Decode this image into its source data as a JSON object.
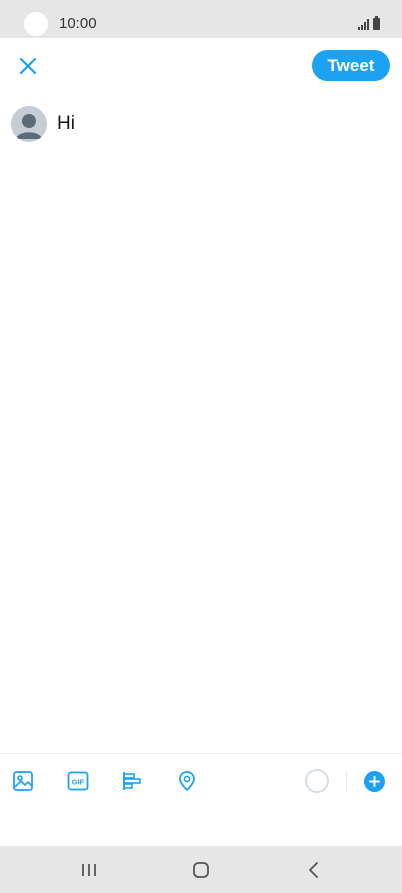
{
  "status_bar": {
    "time": "10:00",
    "icons": [
      "signal-icon",
      "battery-icon"
    ]
  },
  "header": {
    "close_icon": "close-icon",
    "tweet_label": "Tweet"
  },
  "compose": {
    "avatar_icon": "default-avatar-icon",
    "text": "Hi"
  },
  "toolbar": {
    "items": [
      "image-icon",
      "gif-icon",
      "poll-icon",
      "location-icon"
    ],
    "gif_glyph": "GIF",
    "character_counter_icon": "character-counter-ring",
    "add_icon": "plus-icon"
  },
  "navbar": {
    "items": [
      "recent-apps-icon",
      "home-icon",
      "back-icon"
    ]
  },
  "colors": {
    "accent": "#1da1f2",
    "text": "#14171a",
    "icon_gray": "#555555",
    "background": "#ffffff",
    "frame": "#e6e6e6"
  }
}
